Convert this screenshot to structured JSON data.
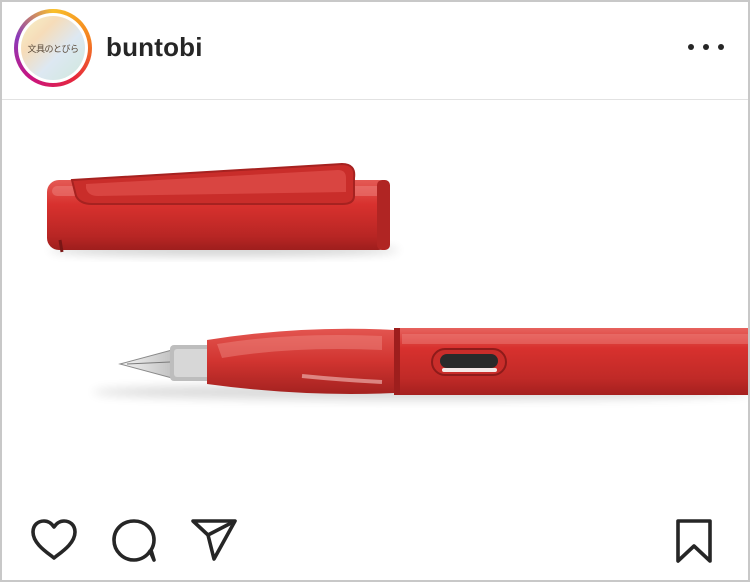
{
  "post": {
    "username": "buntobi",
    "avatar_text": "文具のとびら",
    "more_icon": "more-horizontal-icon",
    "image_subject": "red-fountain-pen-with-cap"
  },
  "actions": {
    "like_icon": "heart-icon",
    "comment_icon": "comment-bubble-icon",
    "share_icon": "paper-plane-icon",
    "save_icon": "bookmark-icon"
  },
  "colors": {
    "pen_red": "#d8312e",
    "icon": "#262626",
    "username": "#262626"
  }
}
